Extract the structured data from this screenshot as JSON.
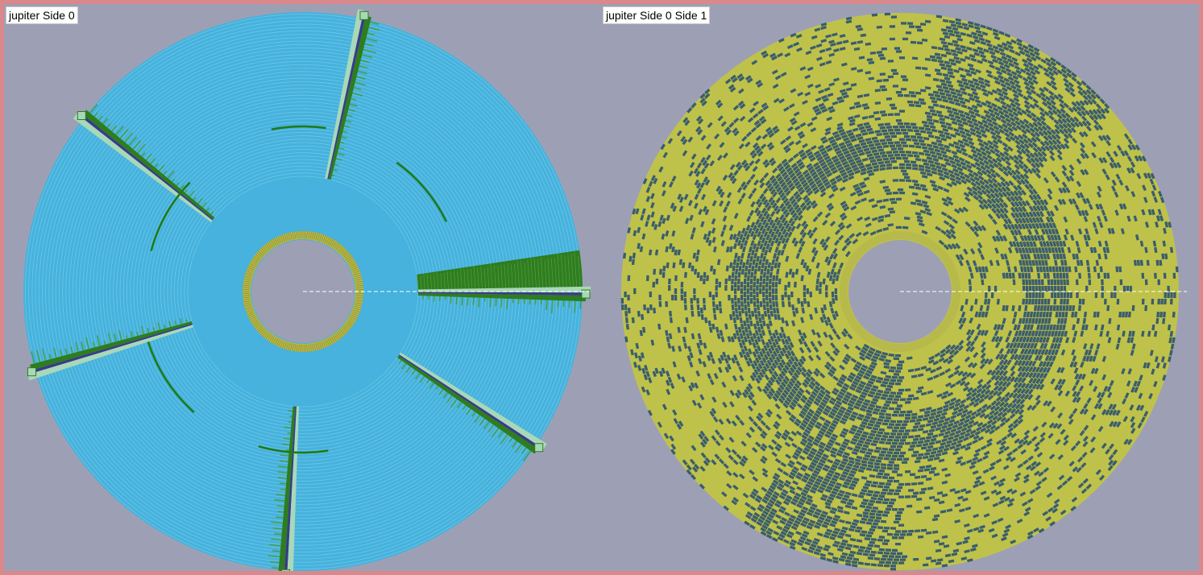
{
  "left_panel": {
    "title": "jupiter Side 0",
    "colors": {
      "track": "#46b2dd",
      "track_line": "#6cc6e6",
      "sector_dark": "#2e7d1e",
      "sector_light": "#a8d8b8",
      "sector_mark": "#3b3a8a",
      "index_ring": "#b7b94a",
      "hub": "#9da0b4",
      "arc": "#1f7a1a",
      "marker": "#ffffff"
    }
  },
  "right_panel": {
    "title": "jupiter Side 0 Side 1",
    "colors": {
      "yellow": "#bfc24a",
      "dark": "#3a5d6e",
      "index_ring": "#b7b94a",
      "hub": "#9da0b4",
      "marker": "#ffffff"
    }
  }
}
